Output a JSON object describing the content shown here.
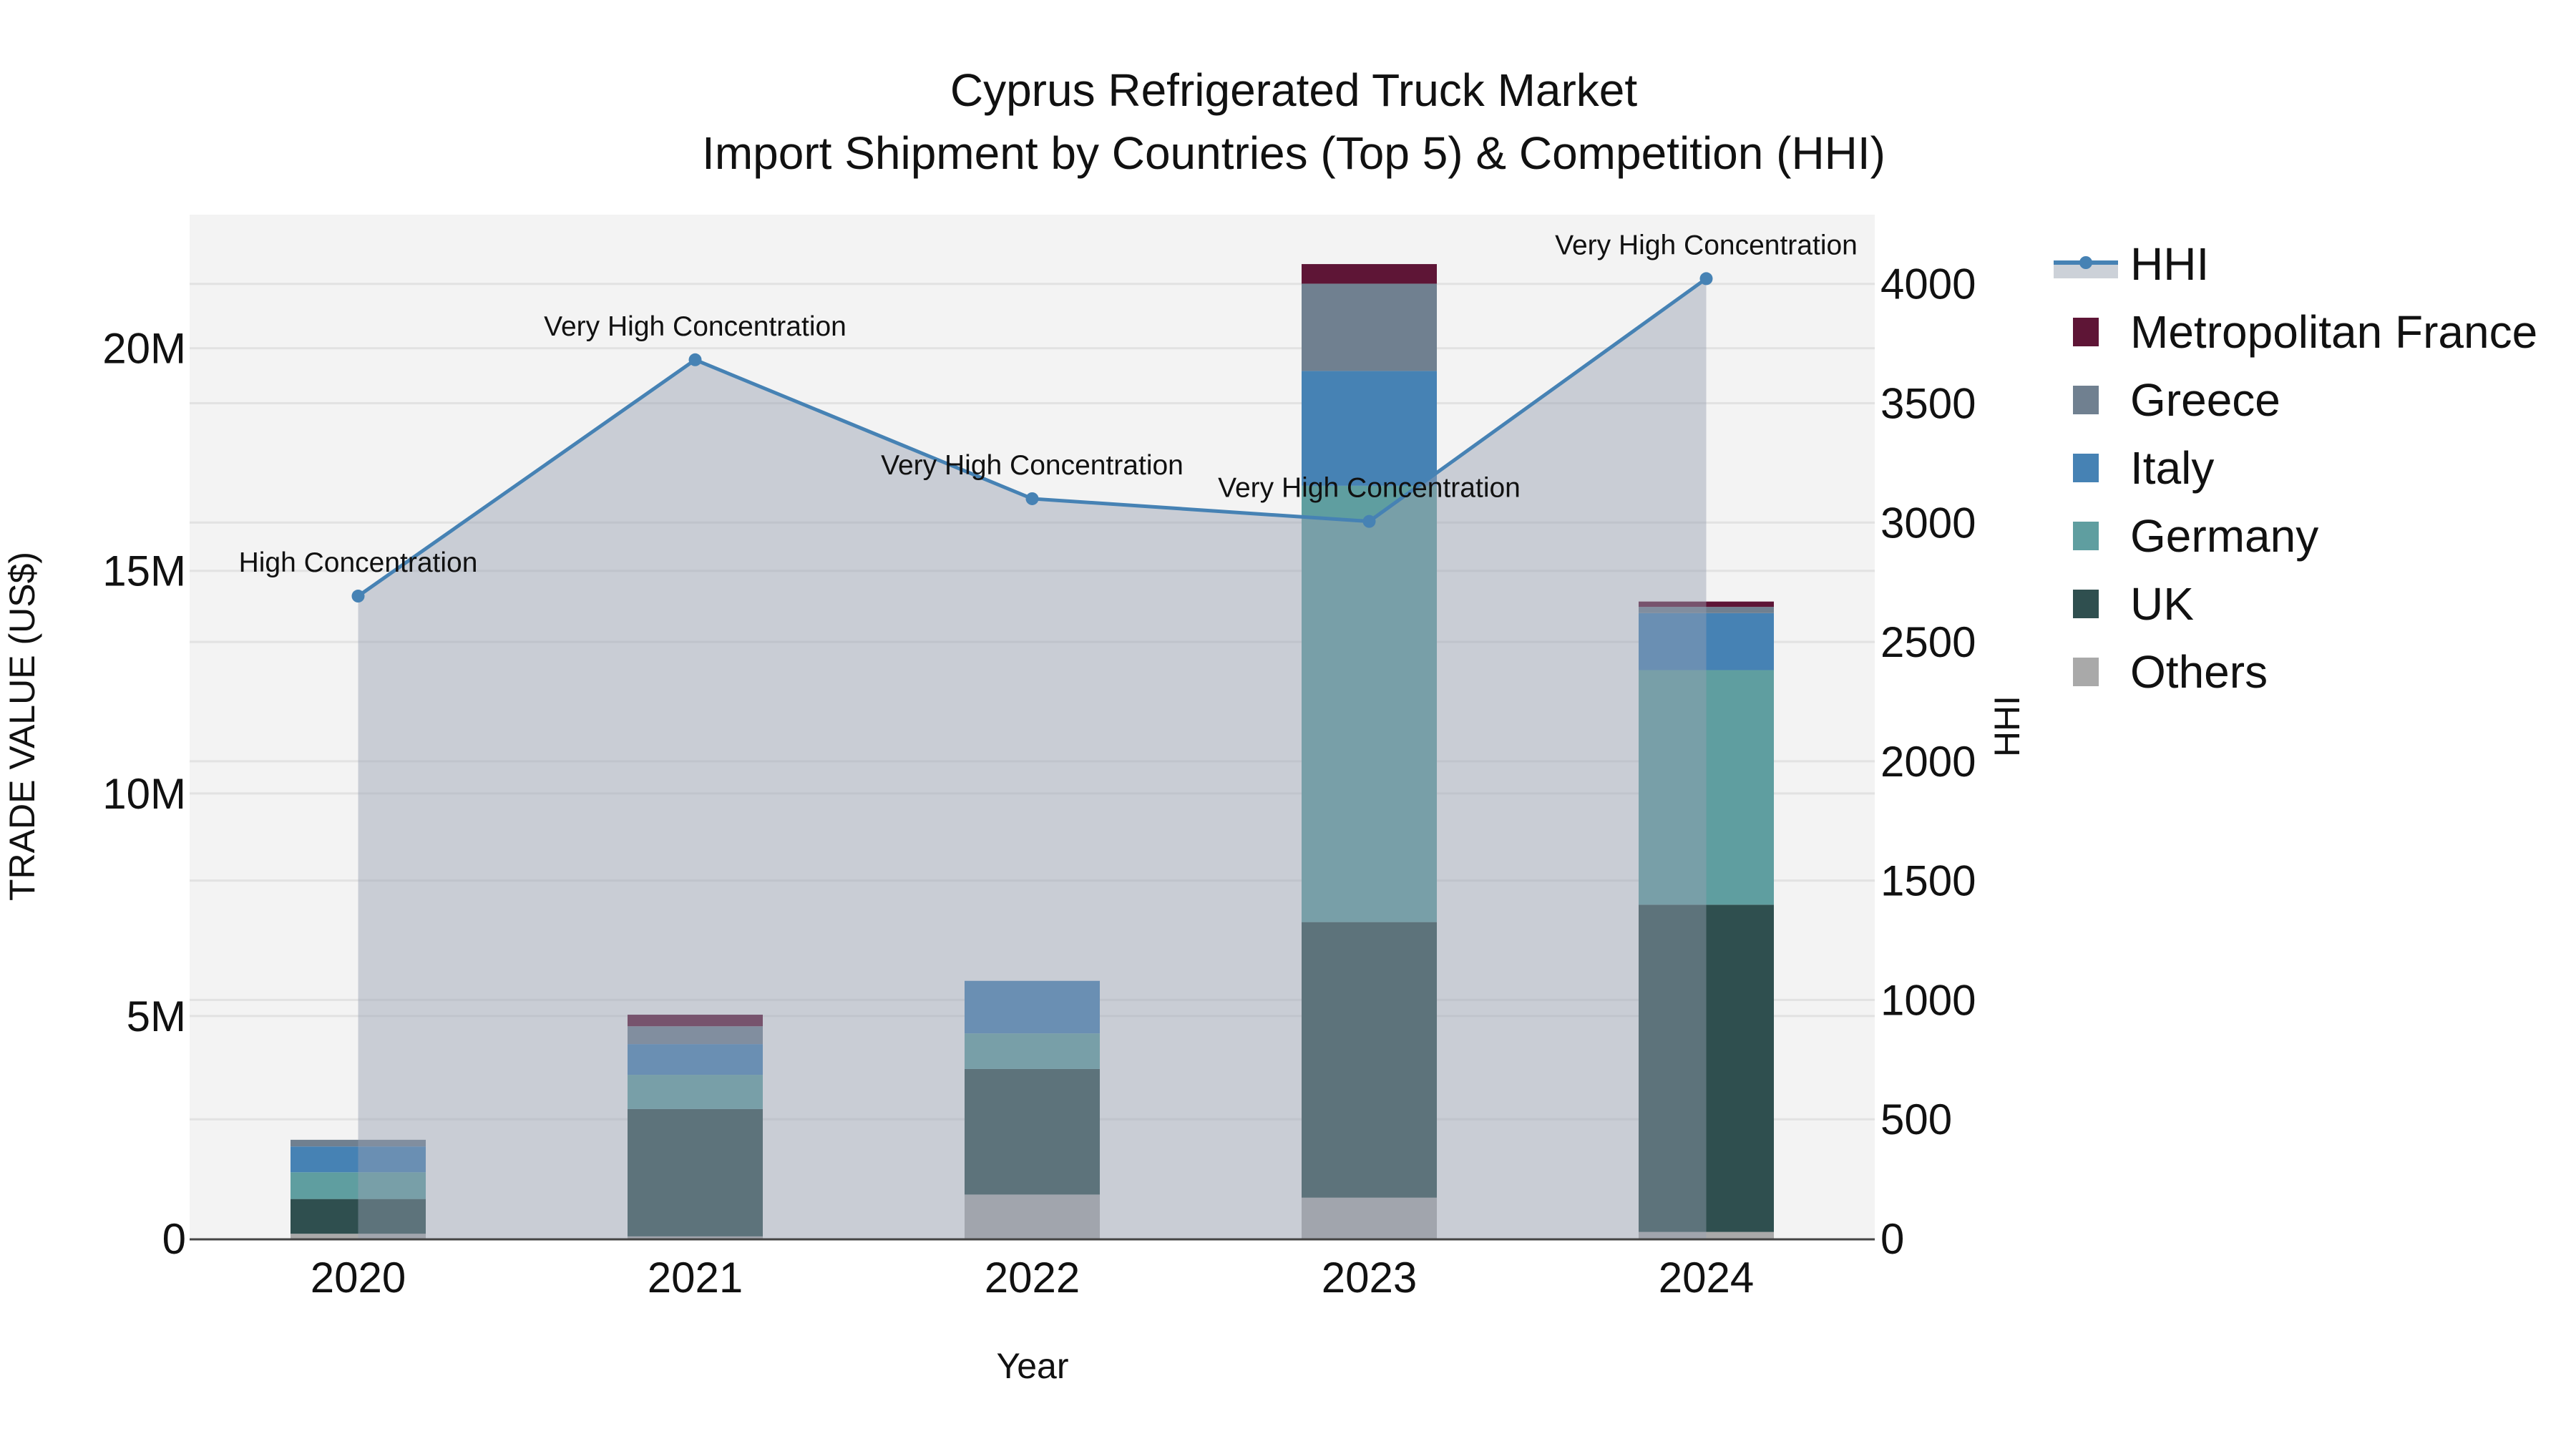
{
  "chart_data": {
    "type": "bar",
    "title": "Cyprus Refrigerated Truck Market",
    "subtitle": "Import Shipment by Countries (Top 5) & Competition (HHI)",
    "xlabel": "Year",
    "ylabel": "TRADE VALUE (US$)",
    "y2label": "HHI",
    "categories": [
      "2020",
      "2021",
      "2022",
      "2023",
      "2024"
    ],
    "stacked": true,
    "ylim": [
      0,
      23000000
    ],
    "y2lim": [
      0,
      4290
    ],
    "yticks": [
      0,
      5000000,
      10000000,
      15000000,
      20000000
    ],
    "ytick_labels": [
      "0",
      "5M",
      "10M",
      "15M",
      "20M"
    ],
    "y2ticks": [
      0,
      500,
      1000,
      1500,
      2000,
      2500,
      3000,
      3500,
      4000
    ],
    "y2tick_labels": [
      "0",
      "500",
      "1000",
      "1500",
      "2000",
      "2500",
      "3000",
      "3500",
      "4000"
    ],
    "grid": true,
    "legend_position": "right",
    "series": [
      {
        "name": "Others",
        "color": "#a9a9a9",
        "values": [
          110000,
          50000,
          990000,
          920000,
          150000
        ]
      },
      {
        "name": "UK",
        "color": "#2f4f4f",
        "values": [
          780000,
          2860000,
          2820000,
          6190000,
          7350000
        ]
      },
      {
        "name": "Germany",
        "color": "#5f9ea0",
        "values": [
          600000,
          770000,
          800000,
          9800000,
          5270000
        ]
      },
      {
        "name": "Italy",
        "color": "#4682b4",
        "values": [
          580000,
          690000,
          1180000,
          2580000,
          1280000
        ]
      },
      {
        "name": "Greece",
        "color": "#708090",
        "values": [
          150000,
          400000,
          0,
          1960000,
          140000
        ]
      },
      {
        "name": "Metropolitan France",
        "color": "#5e1536",
        "values": [
          0,
          260000,
          0,
          440000,
          120000
        ]
      }
    ],
    "line": {
      "name": "HHI",
      "color": "#4682b4",
      "axis": "right",
      "values": [
        2692,
        3682,
        3100,
        3005,
        4022
      ],
      "annotations": [
        "High Concentration",
        "Very High Concentration",
        "Very High Concentration",
        "Very High Concentration",
        "Very High Concentration"
      ]
    },
    "legend_order": [
      "HHI",
      "Metropolitan France",
      "Greece",
      "Italy",
      "Germany",
      "UK",
      "Others"
    ]
  }
}
